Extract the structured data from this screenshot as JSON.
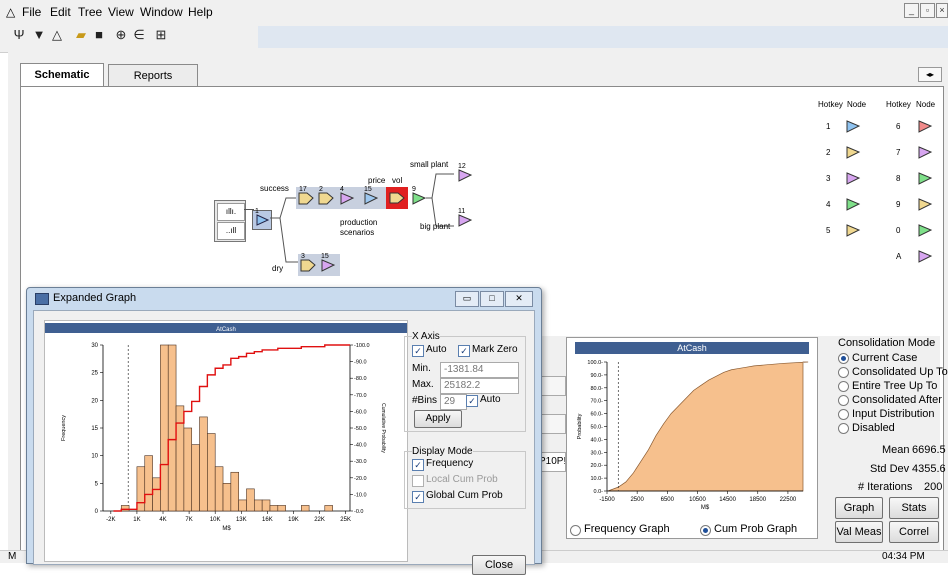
{
  "menubar": {
    "items": [
      "File",
      "Edit",
      "Tree",
      "View",
      "Window",
      "Help"
    ]
  },
  "toolbar": {
    "icons": [
      "tree-shape-icon",
      "funnel-icon",
      "triangle-icon",
      "open-folder-icon",
      "save-icon",
      "expand-icon",
      "collapse-icon",
      "grid-icon"
    ]
  },
  "tabs": [
    "Schematic",
    "Reports"
  ],
  "schematic": {
    "labels": {
      "success": "success",
      "dry": "dry",
      "price": "price",
      "vol": "vol",
      "small_plant": "small plant",
      "big_plant": "big plant",
      "production": "production",
      "scenarios": "scenarios"
    },
    "node_numbers": [
      "1",
      "17",
      "2",
      "4",
      "15",
      "9",
      "3",
      "15",
      "12",
      "11"
    ]
  },
  "hotkeys": {
    "header_col1": "Hotkey",
    "header_col1b": "Node",
    "header_col2": "Hotkey",
    "header_col2b": "Node",
    "left": [
      "1",
      "2",
      "3",
      "4",
      "5"
    ],
    "right": [
      "6",
      "7",
      "8",
      "9",
      "0",
      "A"
    ]
  },
  "dialog": {
    "title": "Expanded Graph",
    "chart_title": "AtCash",
    "x_axis_group": "X Axis",
    "auto_label": "Auto",
    "mark_zero_label": "Mark Zero",
    "min_label": "Min.",
    "min_value": "-1381.84",
    "max_label": "Max.",
    "max_value": "25182.2",
    "bins_label": "#Bins",
    "bins_value": "29",
    "bins_auto_label": "Auto",
    "apply_label": "Apply",
    "display_mode_label": "Display Mode",
    "frequency_label": "Frequency",
    "local_cum_label": "Local Cum Prob",
    "global_cum_label": "Global Cum Prob",
    "close_label": "Close",
    "ylabel_left": "Frequency",
    "ylabel_right": "Cumulative Probability",
    "xlabel": "M$"
  },
  "right_panel": {
    "chart_title": "AtCash",
    "ylabel": "Probability",
    "xlabel": "M$",
    "frequency_graph_label": "Frequency Graph",
    "cum_prob_graph_label": "Cum Prob Graph",
    "consolidation_title": "Consolidation Mode",
    "modes": [
      "Current Case",
      "Consolidated Up To",
      "Entire Tree Up To",
      "Consolidated After",
      "Input Distribution",
      "Disabled"
    ],
    "mean_label": "Mean",
    "mean_value": "6696.5",
    "stddev_label": "Std Dev",
    "stddev_value": "4355.6",
    "iterations_label": "# Iterations",
    "iterations_value": "200",
    "graph_btn": "Graph",
    "stats_btn": "Stats",
    "valmeas_btn": "Val Meas",
    "correl_btn": "Correl",
    "partial_text": "P10P!"
  },
  "statusbar": {
    "left": "M",
    "time": "04:34 PM"
  },
  "chart_data": [
    {
      "type": "bar",
      "title": "AtCash",
      "xlabel": "M$",
      "ylabel": "Frequency",
      "y2label": "Cumulative Probability",
      "x_ticks": [
        "-2K",
        "1K",
        "4K",
        "7K",
        "10K",
        "13K",
        "16K",
        "19K",
        "22K",
        "25K"
      ],
      "y_ticks": [
        0,
        5,
        10,
        15,
        20,
        25,
        30
      ],
      "y2_ticks": [
        "0.0",
        "10.0",
        "20.0",
        "30.0",
        "40.0",
        "50.0",
        "60.0",
        "70.0",
        "80.0",
        "90.0",
        "100.0"
      ],
      "ylim": [
        0,
        30
      ],
      "y2lim": [
        0,
        100
      ],
      "bin_centers": [
        -1250,
        -350,
        550,
        1450,
        2350,
        3250,
        4150,
        5050,
        5950,
        6850,
        7750,
        8650,
        9550,
        10450,
        11350,
        12250,
        13150,
        14050,
        14950,
        15850,
        16750,
        17650,
        18550,
        19450,
        20350,
        21250,
        22150,
        23050,
        23950
      ],
      "series": [
        {
          "name": "Frequency",
          "values": [
            0,
            1,
            0,
            8,
            10,
            6,
            30,
            30,
            19,
            15,
            12,
            17,
            14,
            8,
            5,
            7,
            2,
            4,
            2,
            2,
            1,
            1,
            0,
            0,
            1,
            0,
            0,
            1,
            0
          ]
        },
        {
          "name": "Global Cum Prob",
          "values": [
            0,
            1,
            1,
            5,
            10,
            13,
            28,
            43,
            53,
            60,
            66,
            75,
            82,
            86,
            88,
            92,
            93,
            95,
            96,
            97,
            97,
            98,
            98,
            98,
            99,
            99,
            99,
            100,
            100
          ]
        }
      ]
    },
    {
      "type": "area",
      "title": "AtCash",
      "xlabel": "M$",
      "ylabel": "Probability",
      "x_ticks": [
        "-1500",
        "2500",
        "6500",
        "10500",
        "14500",
        "18500",
        "22500"
      ],
      "y_ticks": [
        "0.0",
        "10.0",
        "20.0",
        "30.0",
        "40.0",
        "50.0",
        "60.0",
        "70.0",
        "80.0",
        "90.0",
        "100.0"
      ],
      "xlim": [
        -1500,
        24500
      ],
      "ylim": [
        0,
        100
      ],
      "x": [
        -1381,
        0,
        1000,
        2000,
        3000,
        4000,
        5000,
        6000,
        7000,
        8000,
        9000,
        10000,
        11000,
        12000,
        13000,
        14000,
        15000,
        16000,
        17000,
        18000,
        20000,
        22000,
        25182
      ],
      "values": [
        0,
        3,
        7,
        14,
        23,
        32,
        43,
        52,
        60,
        66,
        72,
        78,
        82,
        86,
        89,
        92,
        94,
        95,
        96,
        97,
        98,
        99,
        100
      ]
    }
  ]
}
